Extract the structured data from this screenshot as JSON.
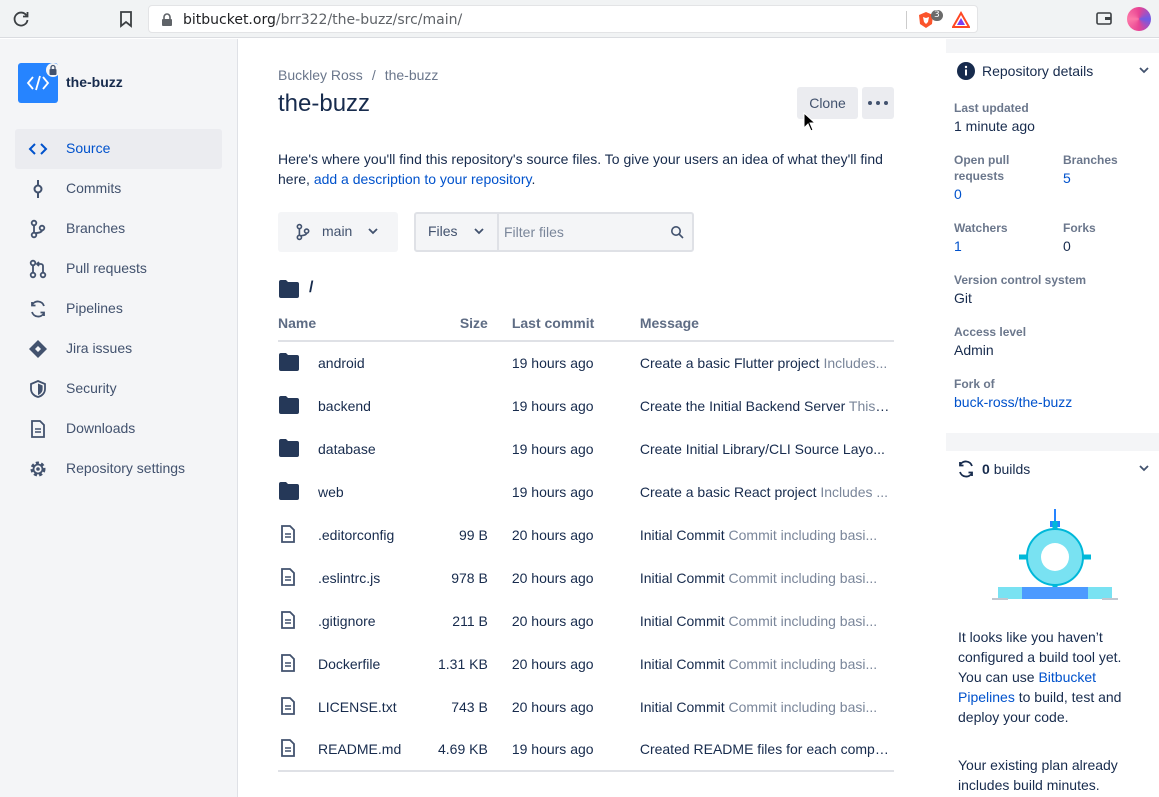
{
  "browser": {
    "url_host": "bitbucket.org",
    "url_path": "/brr322/the-buzz/src/main/",
    "shield_count": "3"
  },
  "sidebar": {
    "repo_name": "the-buzz",
    "items": [
      {
        "label": "Source",
        "icon": "code-icon",
        "active": true
      },
      {
        "label": "Commits",
        "icon": "commit-icon"
      },
      {
        "label": "Branches",
        "icon": "branch-icon"
      },
      {
        "label": "Pull requests",
        "icon": "pull-request-icon"
      },
      {
        "label": "Pipelines",
        "icon": "pipelines-icon"
      },
      {
        "label": "Jira issues",
        "icon": "jira-icon"
      },
      {
        "label": "Security",
        "icon": "shield-icon"
      },
      {
        "label": "Downloads",
        "icon": "document-icon"
      },
      {
        "label": "Repository settings",
        "icon": "gear-icon"
      }
    ]
  },
  "main": {
    "breadcrumb": [
      "Buckley Ross",
      "the-buzz"
    ],
    "title": "the-buzz",
    "clone_label": "Clone",
    "description_text": "Here's where you'll find this repository's source files. To give your users an idea of what they'll find here, ",
    "description_link": "add a description to your repository",
    "description_end": ".",
    "branch": "main",
    "filter_type": "Files",
    "filter_placeholder": "Filter files",
    "path": "/",
    "columns": [
      "Name",
      "Size",
      "Last commit",
      "Message"
    ],
    "rows": [
      {
        "type": "folder",
        "name": "android",
        "size": "",
        "commit": "19 hours ago",
        "msg": "Create a basic Flutter project",
        "sub": " Includes..."
      },
      {
        "type": "folder",
        "name": "backend",
        "size": "",
        "commit": "19 hours ago",
        "msg": "Create the Initial Backend Server",
        "sub": " This ..."
      },
      {
        "type": "folder",
        "name": "database",
        "size": "",
        "commit": "19 hours ago",
        "msg": "Create Initial Library/CLI Source Layo...",
        "sub": ""
      },
      {
        "type": "folder",
        "name": "web",
        "size": "",
        "commit": "19 hours ago",
        "msg": "Create a basic React project",
        "sub": " Includes ..."
      },
      {
        "type": "file",
        "name": ".editorconfig",
        "size": "99 B",
        "commit": "20 hours ago",
        "msg": "Initial Commit",
        "sub": " Commit including basi..."
      },
      {
        "type": "file",
        "name": ".eslintrc.js",
        "size": "978 B",
        "commit": "20 hours ago",
        "msg": "Initial Commit",
        "sub": " Commit including basi..."
      },
      {
        "type": "file",
        "name": ".gitignore",
        "size": "211 B",
        "commit": "20 hours ago",
        "msg": "Initial Commit",
        "sub": " Commit including basi..."
      },
      {
        "type": "file",
        "name": "Dockerfile",
        "size": "1.31 KB",
        "commit": "20 hours ago",
        "msg": "Initial Commit",
        "sub": " Commit including basi..."
      },
      {
        "type": "file",
        "name": "LICENSE.txt",
        "size": "743 B",
        "commit": "20 hours ago",
        "msg": "Initial Commit",
        "sub": " Commit including basi..."
      },
      {
        "type": "file",
        "name": "README.md",
        "size": "4.69 KB",
        "commit": "19 hours ago",
        "msg": "Created README files for each compo...",
        "sub": ""
      }
    ]
  },
  "details": {
    "title": "Repository details",
    "last_updated_label": "Last updated",
    "last_updated": "1 minute ago",
    "open_pr_label": "Open pull requests",
    "open_pr": "0",
    "branches_label": "Branches",
    "branches": "5",
    "watchers_label": "Watchers",
    "watchers": "1",
    "forks_label": "Forks",
    "forks": "0",
    "vcs_label": "Version control system",
    "vcs": "Git",
    "access_label": "Access level",
    "access": "Admin",
    "fork_of_label": "Fork of",
    "fork_of": "buck-ross/the-buzz"
  },
  "builds": {
    "count": "0",
    "label": "builds",
    "text_before": "It looks like you haven’t configured a build tool yet. You can use ",
    "link": "Bitbucket Pipelines",
    "text_after": " to build, test and deploy your code.",
    "text2": "Your existing plan already includes build minutes."
  },
  "colors": {
    "link": "#0052cc",
    "sidebar_bg": "#f4f5f7",
    "folder": "#253858"
  }
}
